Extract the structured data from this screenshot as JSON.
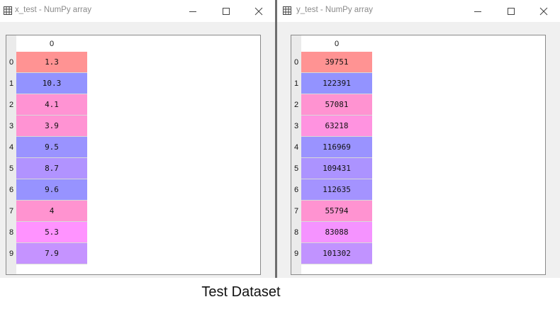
{
  "windows": [
    {
      "id": "left",
      "title": "x_test - NumPy array",
      "column_header": "0",
      "rows": [
        {
          "label": "0",
          "value": "1.3",
          "color": "#ff9393"
        },
        {
          "label": "1",
          "value": "10.3",
          "color": "#9393ff"
        },
        {
          "label": "2",
          "value": "4.1",
          "color": "#ff93d3"
        },
        {
          "label": "3",
          "value": "3.9",
          "color": "#ff93d3"
        },
        {
          "label": "4",
          "value": "9.5",
          "color": "#9a93ff"
        },
        {
          "label": "5",
          "value": "8.7",
          "color": "#b193ff"
        },
        {
          "label": "6",
          "value": "9.6",
          "color": "#9793ff"
        },
        {
          "label": "7",
          "value": "4",
          "color": "#ff93d0"
        },
        {
          "label": "8",
          "value": "5.3",
          "color": "#ff93ff"
        },
        {
          "label": "9",
          "value": "7.9",
          "color": "#c593ff"
        }
      ]
    },
    {
      "id": "right",
      "title": "y_test - NumPy array",
      "column_header": "0",
      "rows": [
        {
          "label": "0",
          "value": "39751",
          "color": "#ff9393"
        },
        {
          "label": "1",
          "value": "122391",
          "color": "#9393ff"
        },
        {
          "label": "2",
          "value": "57081",
          "color": "#ff93d1"
        },
        {
          "label": "3",
          "value": "63218",
          "color": "#ff93e0"
        },
        {
          "label": "4",
          "value": "116969",
          "color": "#9a93ff"
        },
        {
          "label": "5",
          "value": "109431",
          "color": "#ac93ff"
        },
        {
          "label": "6",
          "value": "112635",
          "color": "#a493ff"
        },
        {
          "label": "7",
          "value": "55794",
          "color": "#ff93d1"
        },
        {
          "label": "8",
          "value": "83088",
          "color": "#f593ff"
        },
        {
          "label": "9",
          "value": "101302",
          "color": "#c193ff"
        }
      ]
    }
  ],
  "caption": "Test Dataset",
  "icons": [
    "grid-table-icon",
    "minimize-icon",
    "maximize-icon",
    "close-icon"
  ]
}
